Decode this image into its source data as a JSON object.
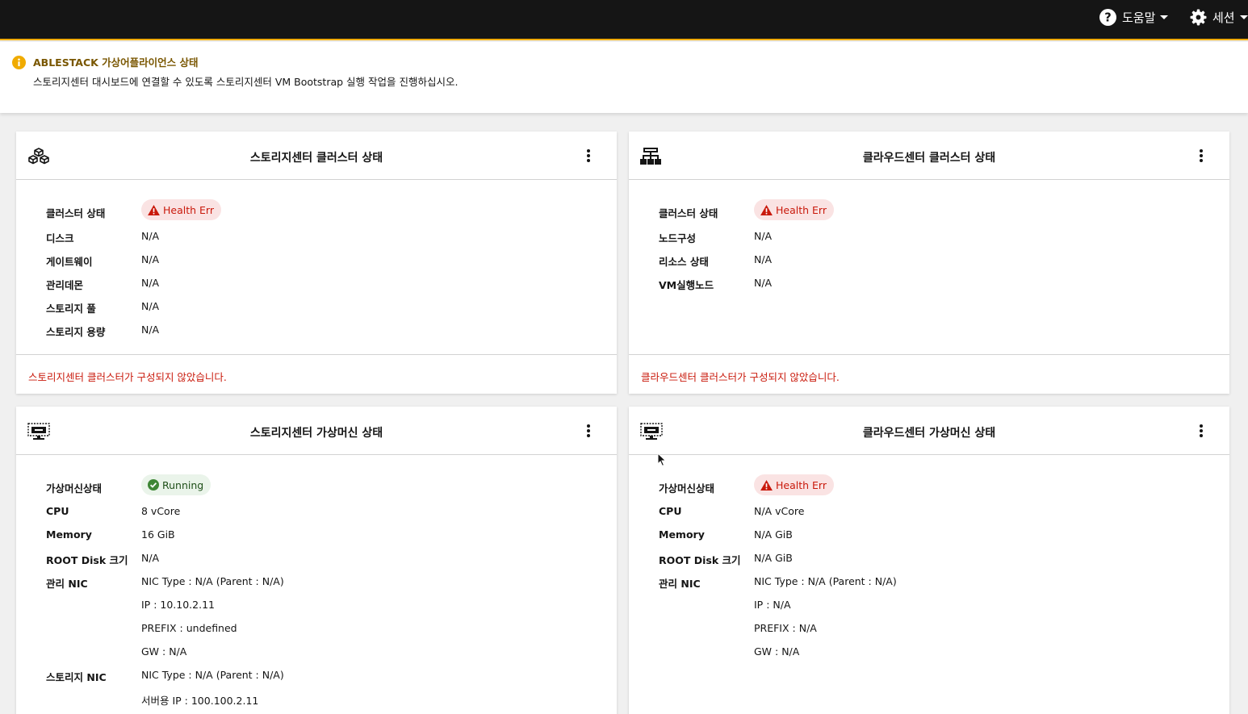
{
  "topbar": {
    "help_label": "도움말",
    "session_label": "세션",
    "help_icon": "question-circle-icon",
    "session_icon": "gear-icon"
  },
  "alert": {
    "icon": "info-circle-icon",
    "title": "ABLESTACK 가상어플라이언스 상태",
    "description": "스토리지센터 대시보드에 연결할 수 있도록 스토리지센터 VM Bootstrap 실행 작업을 진행하십시오."
  },
  "storage_cluster": {
    "title": "스토리지센터 클러스터 상태",
    "icon": "cubes-icon",
    "rows": [
      {
        "key": "클러스터 상태",
        "badge": "Health Err"
      },
      {
        "key": "디스크",
        "value": "N/A"
      },
      {
        "key": "게이트웨이",
        "value": "N/A"
      },
      {
        "key": "관리데몬",
        "value": "N/A"
      },
      {
        "key": "스토리지 풀",
        "value": "N/A"
      },
      {
        "key": "스토리지 용량",
        "value": "N/A"
      }
    ],
    "footer": "스토리지센터 클러스터가 구성되지 않았습니다."
  },
  "cloud_cluster": {
    "title": "클라우드센터 클러스터 상태",
    "icon": "sitemap-icon",
    "rows": [
      {
        "key": "클러스터 상태",
        "badge": "Health Err"
      },
      {
        "key": "노드구성",
        "value": "N/A"
      },
      {
        "key": "리소스 상태",
        "value": "N/A"
      },
      {
        "key": "VM실행노드",
        "value": "N/A"
      }
    ],
    "footer": "클라우드센터 클러스터가 구성되지 않았습니다."
  },
  "storage_vm": {
    "title": "스토리지센터 가상머신 상태",
    "icon": "monitor-icon",
    "rows": [
      {
        "key": "가상머신상태",
        "badge": "Running"
      },
      {
        "key": "CPU",
        "value": "8 vCore"
      },
      {
        "key": "Memory",
        "value": "16 GiB"
      },
      {
        "key": "ROOT Disk 크기",
        "value": "N/A"
      },
      {
        "key": "관리 NIC",
        "value": "NIC Type : N/A (Parent : N/A)"
      },
      {
        "key": "",
        "value": "IP : 10.10.2.11"
      },
      {
        "key": "",
        "value": "PREFIX : undefined"
      },
      {
        "key": "",
        "value": "GW : N/A"
      },
      {
        "key": "스토리지 NIC",
        "value": "NIC Type : N/A (Parent : N/A)"
      },
      {
        "key": "",
        "value": "서버용 IP : 100.100.2.11"
      }
    ]
  },
  "cloud_vm": {
    "title": "클라우드센터 가상머신 상태",
    "icon": "monitor-icon",
    "rows": [
      {
        "key": "가상머신상태",
        "badge": "Health Err"
      },
      {
        "key": "CPU",
        "value": "N/A vCore"
      },
      {
        "key": "Memory",
        "value": "N/A GiB"
      },
      {
        "key": "ROOT Disk 크기",
        "value": "N/A GiB"
      },
      {
        "key": "관리 NIC",
        "value": "NIC Type : N/A (Parent : N/A)"
      },
      {
        "key": "",
        "value": "IP : N/A"
      },
      {
        "key": "",
        "value": "PREFIX : N/A"
      },
      {
        "key": "",
        "value": "GW : N/A"
      }
    ]
  },
  "colors": {
    "topbar": "#151515",
    "accent": "#f0ab00",
    "danger": "#c9190b",
    "success": "#3e8635"
  }
}
